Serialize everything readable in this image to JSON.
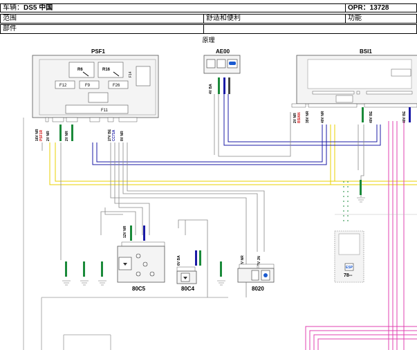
{
  "header": {
    "vehicle_label": "车辆：",
    "vehicle_value": "DS5 中国",
    "opr_label": "OPR：",
    "opr_value": "13728",
    "scope_label": "范围",
    "scope_value": "舒适和便利",
    "function_label": "功能",
    "part_label": "部件",
    "section_title": "原理"
  },
  "modules": {
    "psf1": "PSF1",
    "ae00": "AE00",
    "bsi1": "BSI1",
    "c80c5": "80C5",
    "c80c4": "80C4",
    "c8020": "8020",
    "esp_label": "ESP",
    "esp_code": "78--"
  },
  "psf1_parts": {
    "r6": "R6",
    "r16": "R16",
    "f12": "F12",
    "f9": "F9",
    "f26": "F26",
    "f11": "F11",
    "f14": "F14"
  },
  "connectors": {
    "psf1_a": "16V NR",
    "psf1_a_sub": "PSF1R",
    "psf1_b": "2V NR",
    "psf1_c": "2V NR",
    "psf1_d": "27V BE",
    "psf1_d_sub": "CC71A",
    "psf1_e": "8V NR",
    "ae00_a": "4V BA",
    "bsi1_a": "2V NR",
    "bsi1_a_sub": "BSIAN",
    "bsi1_b": "35V NR",
    "bsi1_c": "40V NR",
    "bsi1_d": "40V BE",
    "bsi1_e": "40V BE",
    "c80c5_a": "12V NR",
    "c80c4_a": "6V BA",
    "c8020_a": "2V NR",
    "c8020_b": "2V JN"
  },
  "colors": {
    "blue": "#1a1aa6",
    "yellow": "#e8d200",
    "pink": "#e040b0",
    "gray": "#888888",
    "green": "#1a8a3a",
    "red": "#d01010"
  }
}
